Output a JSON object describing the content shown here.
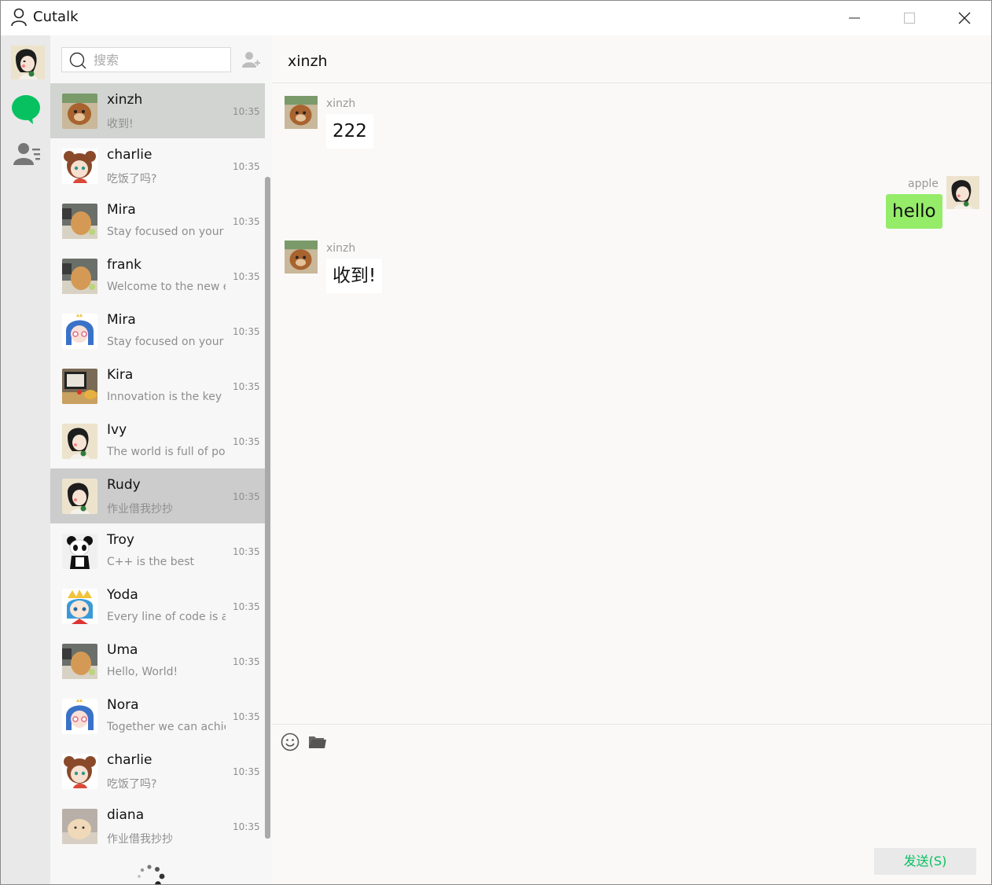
{
  "window": {
    "title": "Cutalk",
    "icons": {
      "app": "user-outline-icon",
      "minimize": "minimize-icon",
      "maximize": "maximize-icon",
      "close": "close-icon"
    }
  },
  "nav": {
    "items": [
      {
        "name": "profile-avatar",
        "icon": "avatar"
      },
      {
        "name": "chats",
        "icon": "chat-bubble-icon",
        "active": true,
        "color": "#07c160"
      },
      {
        "name": "contacts",
        "icon": "contacts-icon"
      }
    ]
  },
  "search": {
    "placeholder": "搜索",
    "add_icon": "add-friend-icon"
  },
  "contacts": [
    {
      "name": "xinzh",
      "preview": "收到!",
      "time": "10:35",
      "avatar": "dog-photo",
      "state": "active"
    },
    {
      "name": "charlie",
      "preview": "吃饭了吗?",
      "time": "10:35",
      "avatar": "bear-girl"
    },
    {
      "name": "Mira",
      "preview": "Stay focused on your goals",
      "time": "10:35",
      "avatar": "potato-photo"
    },
    {
      "name": "frank",
      "preview": "Welcome to the new era",
      "time": "10:35",
      "avatar": "potato-photo"
    },
    {
      "name": "Mira",
      "preview": "Stay focused on your goals",
      "time": "10:35",
      "avatar": "blue-girl"
    },
    {
      "name": "Kira",
      "preview": "Innovation is the key to",
      "time": "10:35",
      "avatar": "desk-photo"
    },
    {
      "name": "Ivy",
      "preview": "The world is full of possibilities",
      "time": "10:35",
      "avatar": "girl-clover"
    },
    {
      "name": "Rudy",
      "preview": "作业借我抄抄",
      "time": "10:35",
      "avatar": "girl-clover",
      "state": "hover"
    },
    {
      "name": "Troy",
      "preview": "C++ is the best",
      "time": "10:35",
      "avatar": "panda-plush"
    },
    {
      "name": "Yoda",
      "preview": "Every line of code is a story",
      "time": "10:35",
      "avatar": "crown-girl"
    },
    {
      "name": "Uma",
      "preview": "Hello, World!",
      "time": "10:35",
      "avatar": "potato-photo"
    },
    {
      "name": "Nora",
      "preview": "Together we can achieve",
      "time": "10:35",
      "avatar": "blue-girl"
    },
    {
      "name": "charlie",
      "preview": "吃饭了吗?",
      "time": "10:35",
      "avatar": "bear-girl"
    },
    {
      "name": "diana",
      "preview": "作业借我抄抄",
      "time": "10:35",
      "avatar": "bun-photo"
    }
  ],
  "chat": {
    "title": "xinzh",
    "messages": [
      {
        "sender": "xinzh",
        "text": "222",
        "side": "left",
        "avatar": "dog-photo"
      },
      {
        "sender": "apple",
        "text": "hello",
        "side": "right",
        "avatar": "girl-clover"
      },
      {
        "sender": "xinzh",
        "text": "收到!",
        "side": "left",
        "avatar": "dog-photo"
      }
    ]
  },
  "composer": {
    "emoji_icon": "smiley-icon",
    "file_icon": "folder-icon",
    "send_label": "发送(S)",
    "send_color": "#07c160"
  },
  "colors": {
    "accent": "#07c160",
    "my_bubble": "#95ec69",
    "active_item": "#d1d4d1",
    "nav_bg": "#e9e9e9"
  }
}
